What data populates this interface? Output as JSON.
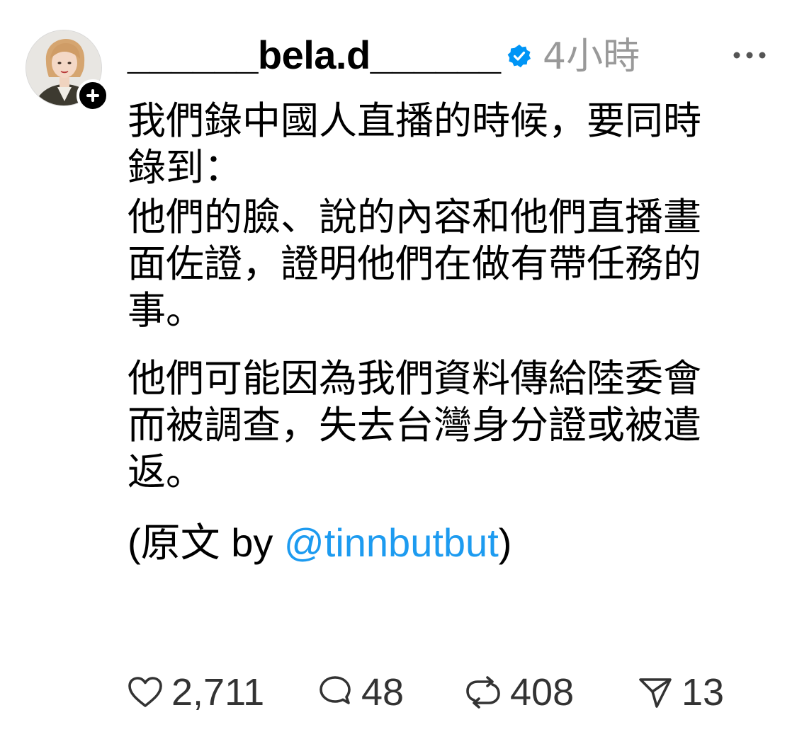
{
  "post": {
    "author": {
      "username": "______bela.d______",
      "verified": true,
      "avatar_icon": "avatar-photo",
      "follow_icon": "plus-icon"
    },
    "timestamp": "4小時",
    "more_icon": "more-horizontal-icon",
    "paragraphs": [
      "我們錄中國人直播的時候，要同時\n錄到：",
      "他們的臉、說的內容和他們直播畫\n面佐證，證明他們在做有帶任務的\n事。",
      "他們可能因為我們資料傳給陸委會\n而被調查，失去台灣身分證或被遣\n返。"
    ],
    "credit": {
      "prefix": "(原文 by ",
      "mention": "@tinnbutbut",
      "suffix": ")"
    },
    "actions": {
      "likes": "2,711",
      "replies": "48",
      "reposts": "408",
      "shares": "13"
    }
  },
  "colors": {
    "text": "#000000",
    "muted": "#999999",
    "link": "#1d9bf0",
    "verified": "#0095f6",
    "counts": "#333333"
  }
}
